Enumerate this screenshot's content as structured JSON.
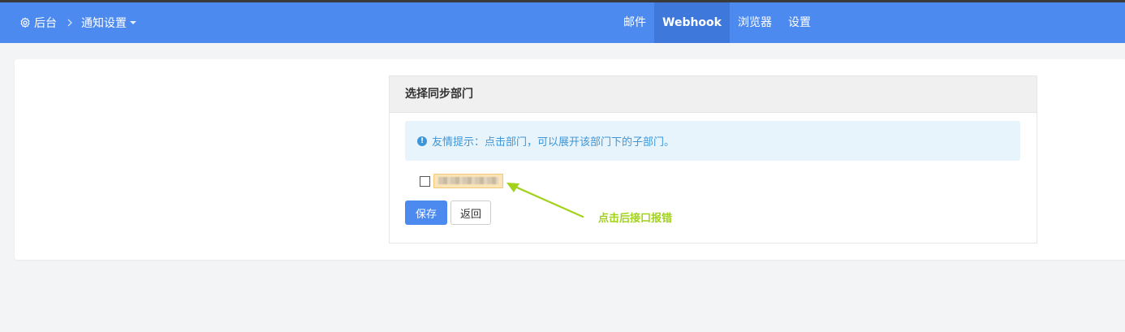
{
  "nav": {
    "home_label": "后台",
    "section_label": "通知设置",
    "tabs": [
      {
        "label": "邮件"
      },
      {
        "label": "Webhook"
      },
      {
        "label": "浏览器"
      },
      {
        "label": "设置"
      }
    ],
    "active_tab": "Webhook"
  },
  "card": {
    "title": "选择同步部门",
    "tip": "友情提示：点击部门，可以展开该部门下的子部门。"
  },
  "buttons": {
    "save": "保存",
    "back": "返回"
  },
  "annotation": {
    "text": "点击后接口报错"
  },
  "colors": {
    "navbar": "#4d8af0",
    "primary": "#4d8af0",
    "tip_text": "#3d96d8",
    "annotation": "#a2d21c"
  },
  "icons": {
    "home": "gear-icon",
    "separator": "chevron-right-icon",
    "dropdown": "caret-down-icon",
    "tip": "info-icon"
  }
}
